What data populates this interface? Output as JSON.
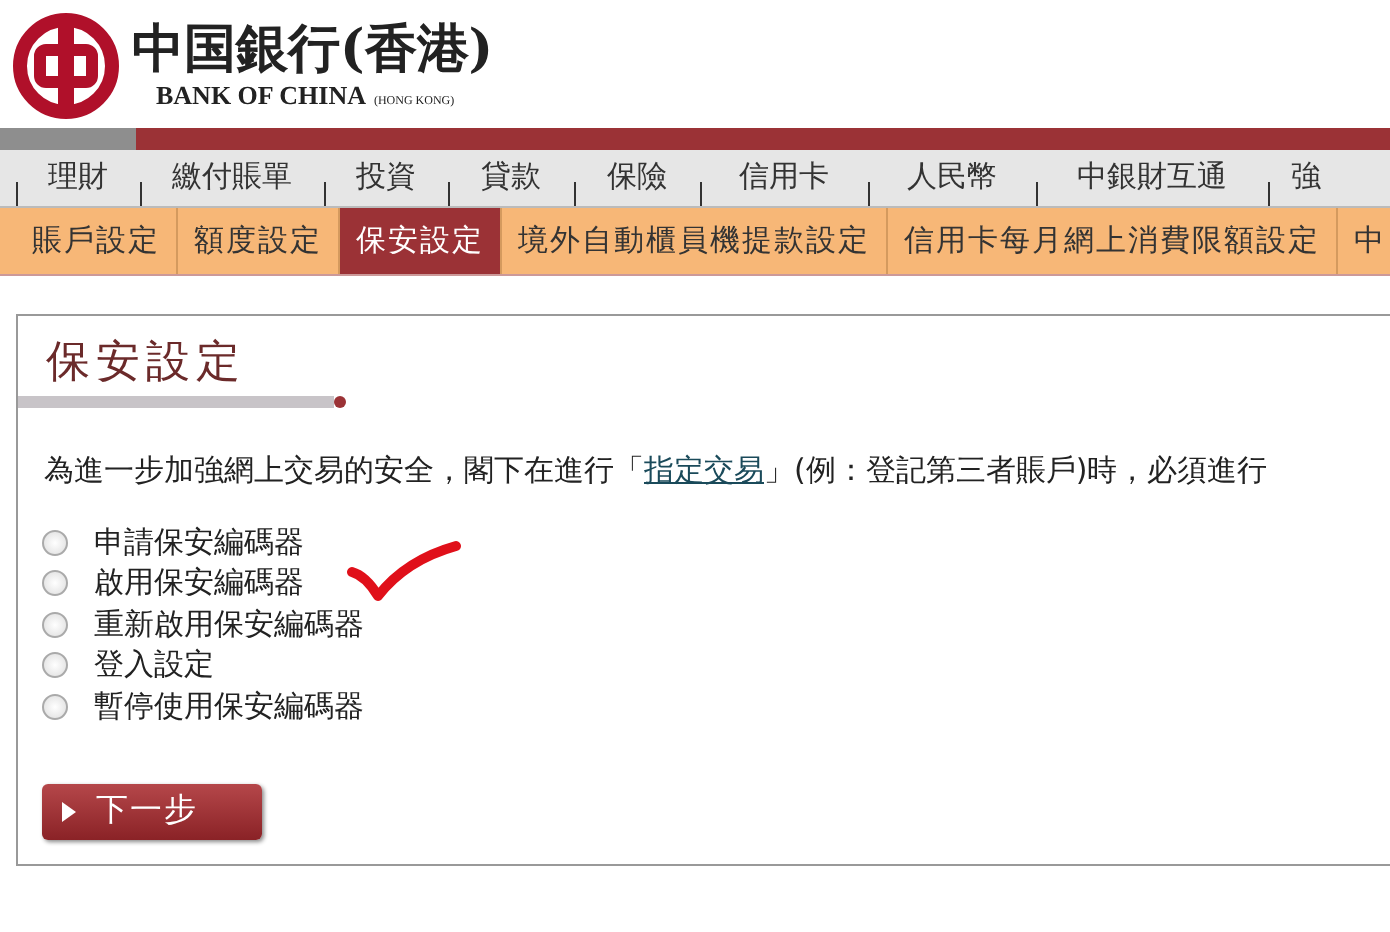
{
  "header": {
    "logo_title": "中国銀行(香港)",
    "logo_subtitle": "BANK OF CHINA",
    "logo_region": "(HONG KONG)"
  },
  "main_nav": [
    {
      "label": "理財",
      "selected": false
    },
    {
      "label": "繳付賬單",
      "selected": false
    },
    {
      "label": "投資",
      "selected": false
    },
    {
      "label": "貸款",
      "selected": false
    },
    {
      "label": "保險",
      "selected": false
    },
    {
      "label": "信用卡",
      "selected": false
    },
    {
      "label": "人民幣",
      "selected": false
    },
    {
      "label": "中銀財互通",
      "selected": false
    },
    {
      "label": "強",
      "selected": false
    }
  ],
  "sub_nav": [
    {
      "label": "賬戶設定",
      "selected": false
    },
    {
      "label": "額度設定",
      "selected": false
    },
    {
      "label": "保安設定",
      "selected": true
    },
    {
      "label": "境外自動櫃員機提款設定",
      "selected": false
    },
    {
      "label": "信用卡每月網上消費限額設定",
      "selected": false
    },
    {
      "label": "中",
      "selected": false
    }
  ],
  "panel": {
    "title": "保安設定",
    "intro": "為進一步加強網上交易的安全，閣下在進行「",
    "intro_link": "指定交易",
    "intro_rest": "」(例：登記第三者賬戶)時，必須進行",
    "options": [
      {
        "label": "申請保安編碼器",
        "selected": false,
        "marked": false
      },
      {
        "label": "啟用保安編碼器",
        "selected": false,
        "marked": true
      },
      {
        "label": "重新啟用保安編碼器",
        "selected": false,
        "marked": false
      },
      {
        "label": "登入設定",
        "selected": false,
        "marked": false
      },
      {
        "label": "暫停使用保安編碼器",
        "selected": false,
        "marked": false
      }
    ],
    "next_button": "下一步"
  }
}
